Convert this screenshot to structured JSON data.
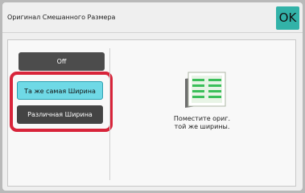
{
  "header": {
    "title": "Оригинал Смешанного Размера",
    "ok_label": "OK"
  },
  "options": [
    {
      "label": "Off",
      "selected": false
    },
    {
      "label": "Та же самая Ширина",
      "selected": true
    },
    {
      "label": "Различная Ширина",
      "selected": false
    }
  ],
  "hint": {
    "line1": "Поместите ориг.",
    "line2": "той же ширины."
  },
  "colors": {
    "accent": "#32b2a8",
    "selected": "#6fd9e6",
    "highlight": "#d8243a"
  },
  "icons": {
    "illustration": "original-documents-icon"
  }
}
